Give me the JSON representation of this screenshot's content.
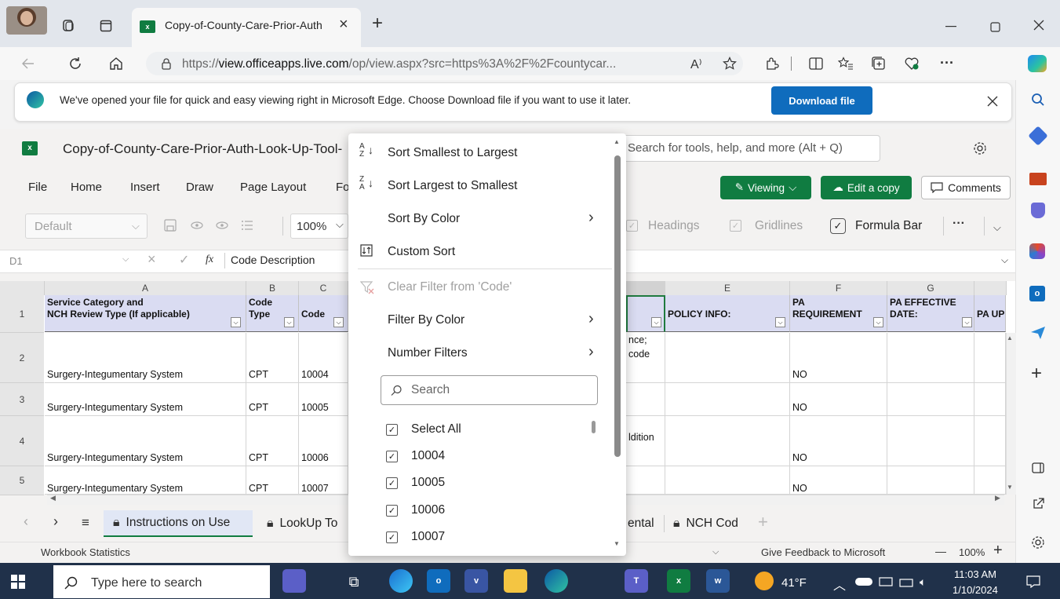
{
  "browser": {
    "tab_title": "Copy-of-County-Care-Prior-Auth",
    "tab_close": "×",
    "new_tab": "+",
    "url_prefix": "https://",
    "url_host": "view.officeapps.live.com",
    "url_rest": "/op/view.aspx?src=https%3A%2F%2Fcountycar...",
    "read_aloud": "A⁾",
    "more": "···"
  },
  "infobar": {
    "message": "We've opened your file for quick and easy viewing right in Microsoft Edge. Choose Download file if you want to use it later.",
    "download_label": "Download file"
  },
  "excel": {
    "file_title": "Copy-of-County-Care-Prior-Auth-Look-Up-Tool-",
    "search_placeholder": "Search for tools, help, and more (Alt + Q)",
    "ribbon_tabs": [
      "File",
      "Home",
      "Insert",
      "Draw",
      "Page Layout",
      "Fo"
    ],
    "viewing_label": "Viewing",
    "edit_copy_label": "Edit a copy",
    "comments_label": "Comments",
    "style_box": "Default",
    "zoom_box": "100%",
    "headings_label": "Headings",
    "gridlines_label": "Gridlines",
    "formula_bar_label": "Formula Bar",
    "name_box": "D1",
    "formula_fx": "fx",
    "formula_value": "Code Description",
    "columns": [
      "A",
      "B",
      "C",
      "E",
      "F",
      "G"
    ],
    "rows": [
      "1",
      "2",
      "3",
      "4",
      "5"
    ],
    "headers": {
      "a_line1": "Service Category and",
      "a_line2": "NCH Review Type (If applicable)",
      "b_line1": "Code",
      "b_line2": "Type",
      "c": "Code",
      "e": "POLICY INFO:",
      "f_line1": "PA",
      "f_line2": "REQUIREMENT",
      "g_line1": "PA EFFECTIVE",
      "g_line2": "DATE:",
      "h": "PA UP"
    },
    "data_rows": [
      {
        "category": "Surgery-Integumentary System",
        "type": "CPT",
        "code": "10004",
        "pa": "NO"
      },
      {
        "category": "Surgery-Integumentary System",
        "type": "CPT",
        "code": "10005",
        "pa": "NO"
      },
      {
        "category": "Surgery-Integumentary System",
        "type": "CPT",
        "code": "10006",
        "pa": "NO"
      },
      {
        "category": "Surgery-Integumentary System",
        "type": "CPT",
        "code": "10007",
        "pa": "NO"
      }
    ],
    "desc_fragments": [
      "nce;",
      "code",
      "ldition"
    ],
    "sheet_tabs": [
      "Instructions on Use",
      "LookUp To",
      "ental",
      "NCH Cod"
    ],
    "add_sheet": "+",
    "status_left": "Workbook Statistics",
    "feedback": "Give Feedback to Microsoft",
    "zoom_minus": "—",
    "zoom_level": "100%",
    "zoom_plus": "+"
  },
  "menu": {
    "sort_asc": "Sort Smallest to Largest",
    "sort_desc": "Sort Largest to Smallest",
    "sort_color": "Sort By Color",
    "custom_sort": "Custom Sort",
    "clear_filter": "Clear Filter from 'Code'",
    "filter_color": "Filter By Color",
    "number_filters": "Number Filters",
    "search_placeholder": "Search",
    "items": [
      "Select All",
      "10004",
      "10005",
      "10006",
      "10007"
    ]
  },
  "taskbar": {
    "search_placeholder": "Type here to search",
    "temperature": "41°F",
    "time": "11:03 AM",
    "date": "1/10/2024"
  },
  "colors": {
    "excel_green": "#107c41",
    "edge_blue": "#0f6cbd",
    "header_fill": "#dadcf2",
    "taskbar": "#20314a"
  }
}
